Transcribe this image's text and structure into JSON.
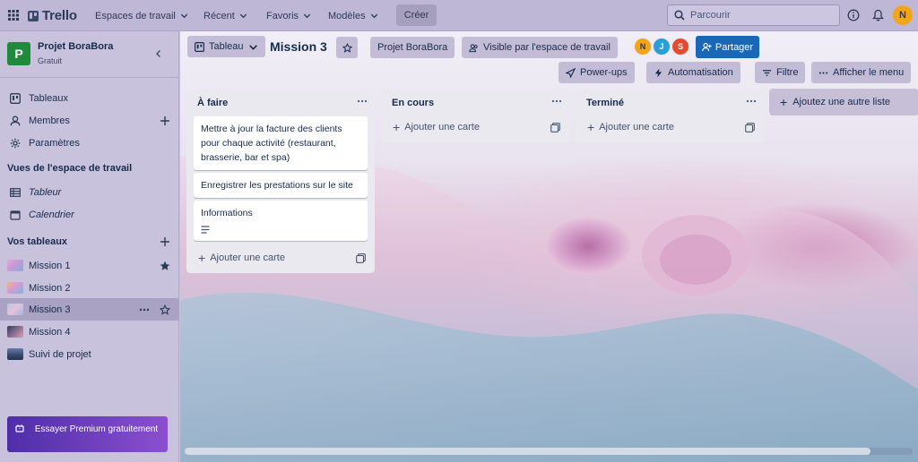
{
  "app": {
    "name": "Trello"
  },
  "topbar": {
    "nav": [
      "Espaces de travail",
      "Récent",
      "Favoris",
      "Modèles"
    ],
    "create_label": "Créer",
    "search_placeholder": "Parcourir",
    "user_initial": "N"
  },
  "sidebar": {
    "workspace_name": "Projet BoraBora",
    "workspace_initial": "P",
    "workspace_plan": "Gratuit",
    "items": [
      {
        "label": "Tableaux",
        "icon": "board-icon"
      },
      {
        "label": "Membres",
        "icon": "person-icon"
      },
      {
        "label": "Paramètres",
        "icon": "gear-icon"
      }
    ],
    "views_title": "Vues de l'espace de travail",
    "views": [
      {
        "label": "Tableur",
        "icon": "table-icon"
      },
      {
        "label": "Calendrier",
        "icon": "calendar-icon"
      }
    ],
    "boards_title": "Vos tableaux",
    "boards": [
      {
        "label": "Mission 1",
        "starred": true
      },
      {
        "label": "Mission 2",
        "starred": false
      },
      {
        "label": "Mission 3",
        "starred": false,
        "active": true
      },
      {
        "label": "Mission 4",
        "starred": false
      },
      {
        "label": "Suivi de projet",
        "starred": false
      }
    ],
    "premium_label": "Essayer Premium gratuitement"
  },
  "board": {
    "view_label": "Tableau",
    "title": "Mission 3",
    "workspace_label": "Projet BoraBora",
    "visibility_label": "Visible par l'espace de travail",
    "members": [
      {
        "initial": "N",
        "color": "#f2a517"
      },
      {
        "initial": "J",
        "color": "#2a9fd6"
      },
      {
        "initial": "S",
        "color": "#e34a2f"
      }
    ],
    "share_label": "Partager",
    "powerups_label": "Power-ups",
    "automation_label": "Automatisation",
    "filter_label": "Filtre",
    "menu_label": "Afficher le menu",
    "lists": [
      {
        "title": "À faire",
        "cards": [
          {
            "text": "Mettre à jour la facture des clients pour chaque activité (restaurant, brasserie, bar et spa)"
          },
          {
            "text": "Enregistrer les prestations sur le site"
          },
          {
            "text": "Informations",
            "has_description": true
          }
        ],
        "add_label": "Ajouter une carte"
      },
      {
        "title": "En cours",
        "cards": [],
        "add_label": "Ajouter une carte"
      },
      {
        "title": "Terminé",
        "cards": [],
        "add_label": "Ajouter une carte"
      }
    ],
    "add_list_label": "Ajoutez une autre liste"
  },
  "colors": {
    "share_button": "#1a68b5",
    "premium_gradient_start": "#4e2ea8",
    "premium_gradient_end": "#8b4fd0",
    "workspace_logo": "#1f8a3c"
  }
}
